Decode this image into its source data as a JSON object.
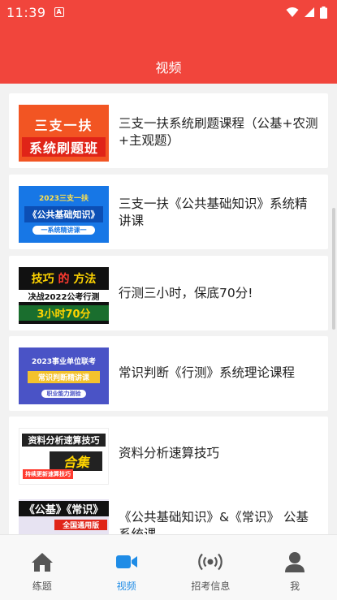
{
  "status_bar": {
    "time": "11:39",
    "app_icon_letter": "A"
  },
  "header": {
    "title": "视频"
  },
  "videos": [
    {
      "title": "三支一扶系统刷题课程（公基+农测+主观题）",
      "thumb": [
        "三支一扶",
        "系统刷题班"
      ]
    },
    {
      "title": "三支一扶《公共基础知识》系统精讲课",
      "thumb": [
        "2023三支一扶",
        "《公共基础知识》",
        "一系统精讲课一"
      ]
    },
    {
      "title": "行测三小时，保底70分!",
      "thumb": [
        "技巧",
        "的",
        "方法",
        "决战2022公考行测",
        "3小时70分"
      ]
    },
    {
      "title": "常识判断《行测》系统理论课程",
      "thumb": [
        "2023事业单位联考",
        "常识判断精讲课",
        "职业能力测验"
      ]
    },
    {
      "title": "资料分析速算技巧",
      "thumb": [
        "资料分析速算技巧",
        "合集",
        "持续更新速算技巧"
      ]
    },
    {
      "title": "《公共基础知识》&《常识》 公基系统课",
      "thumb": [
        "《公基》《常识》",
        "全国通用版"
      ]
    }
  ],
  "nav": [
    {
      "label": "练题",
      "icon": "home-icon",
      "active": false
    },
    {
      "label": "视频",
      "icon": "video-icon",
      "active": true
    },
    {
      "label": "招考信息",
      "icon": "broadcast-icon",
      "active": false
    },
    {
      "label": "我",
      "icon": "user-icon",
      "active": false
    }
  ],
  "colors": {
    "brand": "#f1453c",
    "active": "#1f8ce6"
  }
}
